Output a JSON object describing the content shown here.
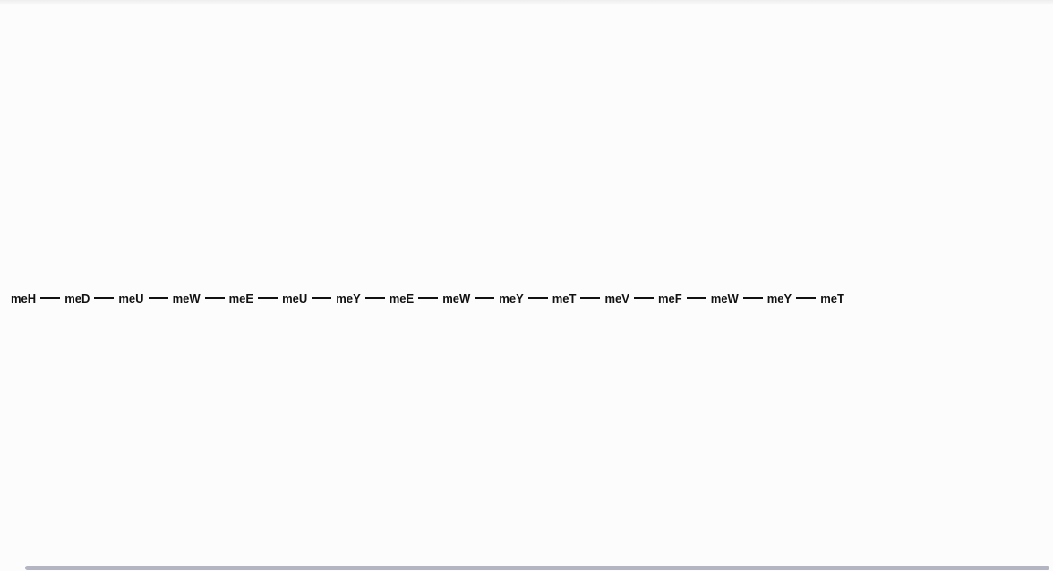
{
  "sequence": {
    "nodes": [
      "meH",
      "meD",
      "meU",
      "meW",
      "meE",
      "meU",
      "meY",
      "meE",
      "meW",
      "meY",
      "meT",
      "meV",
      "meF",
      "meW",
      "meY",
      "meT"
    ]
  },
  "colors": {
    "background": "#fcfcfc",
    "text": "#111111",
    "connector": "#111111",
    "scrollbar_thumb": "#b3b6c2"
  }
}
